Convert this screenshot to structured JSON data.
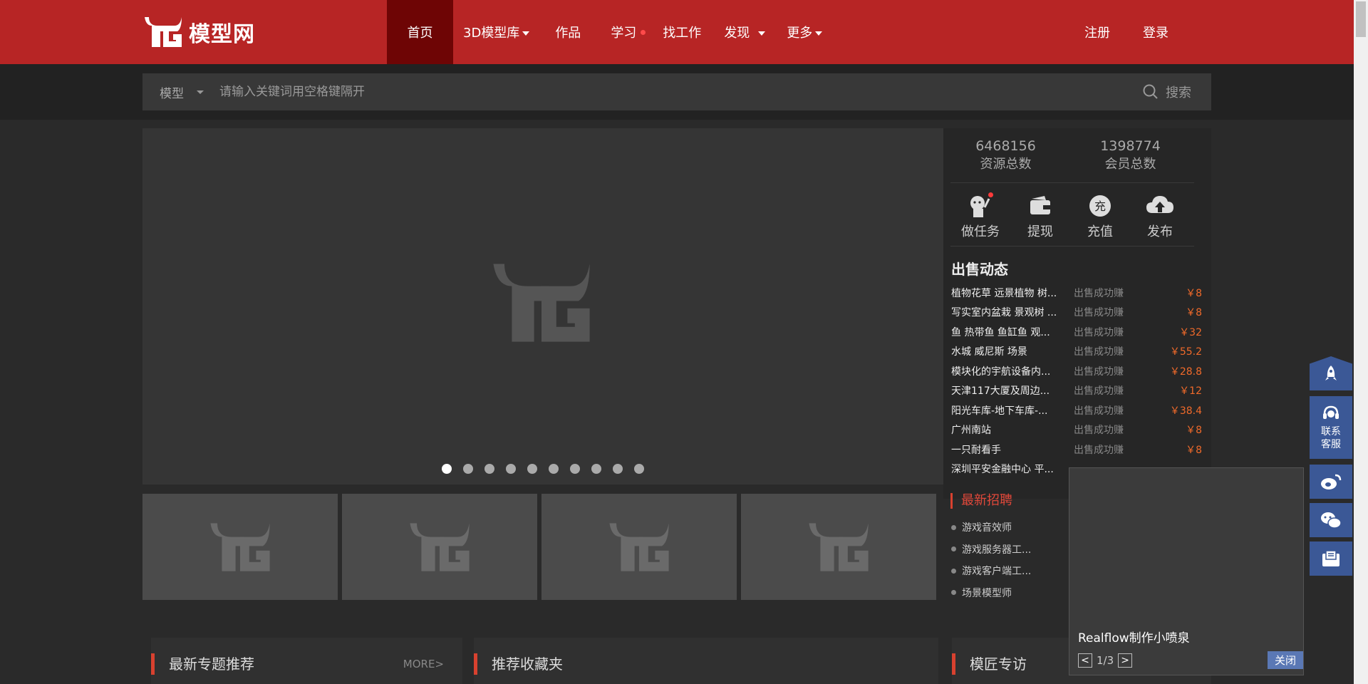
{
  "logo": {
    "text": "模型网"
  },
  "nav": [
    {
      "label": "首页",
      "active": true
    },
    {
      "label": "3D模型库",
      "caret": true
    },
    {
      "label": "作品"
    },
    {
      "label": "学习",
      "dot": true
    },
    {
      "label": "找工作"
    },
    {
      "label": "发现",
      "caret": true
    },
    {
      "label": "更多",
      "caret": true
    }
  ],
  "auth": {
    "register": "注册",
    "login": "登录"
  },
  "search": {
    "type": "模型",
    "placeholder": "请输入关键词用空格键隔开",
    "button": "搜索"
  },
  "stats": [
    {
      "num": "6468156",
      "label": "资源总数"
    },
    {
      "num": "1398774",
      "label": "会员总数"
    }
  ],
  "actions": [
    {
      "label": "做任务",
      "icon": "task-icon"
    },
    {
      "label": "提现",
      "icon": "wallet-icon"
    },
    {
      "label": "充值",
      "icon": "recharge-icon"
    },
    {
      "label": "发布",
      "icon": "upload-cloud-icon"
    }
  ],
  "sales": {
    "title": "出售动态",
    "items": [
      {
        "title": "植物花草 远景植物 树...",
        "status": "出售成功赚",
        "price": "￥8"
      },
      {
        "title": "写实室内盆栽 景观树 ...",
        "status": "出售成功赚",
        "price": "￥8"
      },
      {
        "title": "鱼 热带鱼 鱼缸鱼 观...",
        "status": "出售成功赚",
        "price": "￥32"
      },
      {
        "title": "水城 威尼斯 场景",
        "status": "出售成功赚",
        "price": "￥55.2"
      },
      {
        "title": "模块化的宇航设备内...",
        "status": "出售成功赚",
        "price": "￥28.8"
      },
      {
        "title": "天津117大厦及周边...",
        "status": "出售成功赚",
        "price": "￥12"
      },
      {
        "title": "阳光车库-地下车库-...",
        "status": "出售成功赚",
        "price": "￥38.4"
      },
      {
        "title": "广州南站",
        "status": "出售成功赚",
        "price": "￥8"
      },
      {
        "title": "一只耐看手",
        "status": "出售成功赚",
        "price": "￥8"
      },
      {
        "title": "深圳平安金融中心 平...",
        "status": "",
        "price": ""
      }
    ]
  },
  "jobs": {
    "title": "最新招聘",
    "items": [
      "游戏音效师",
      "游戏服务器工...",
      "游戏客户端工...",
      "场景模型师"
    ]
  },
  "panels": [
    {
      "title": "最新专题推荐",
      "more": "MORE>"
    },
    {
      "title": "推荐收藏夹"
    },
    {
      "title": "模匠专访"
    }
  ],
  "popup": {
    "title": "Realflow制作小喷泉",
    "page": "1/3",
    "prev": "<",
    "next": ">",
    "close": "关闭"
  },
  "float": {
    "service": "联系\n客服",
    "service_line1": "联系",
    "service_line2": "客服"
  }
}
